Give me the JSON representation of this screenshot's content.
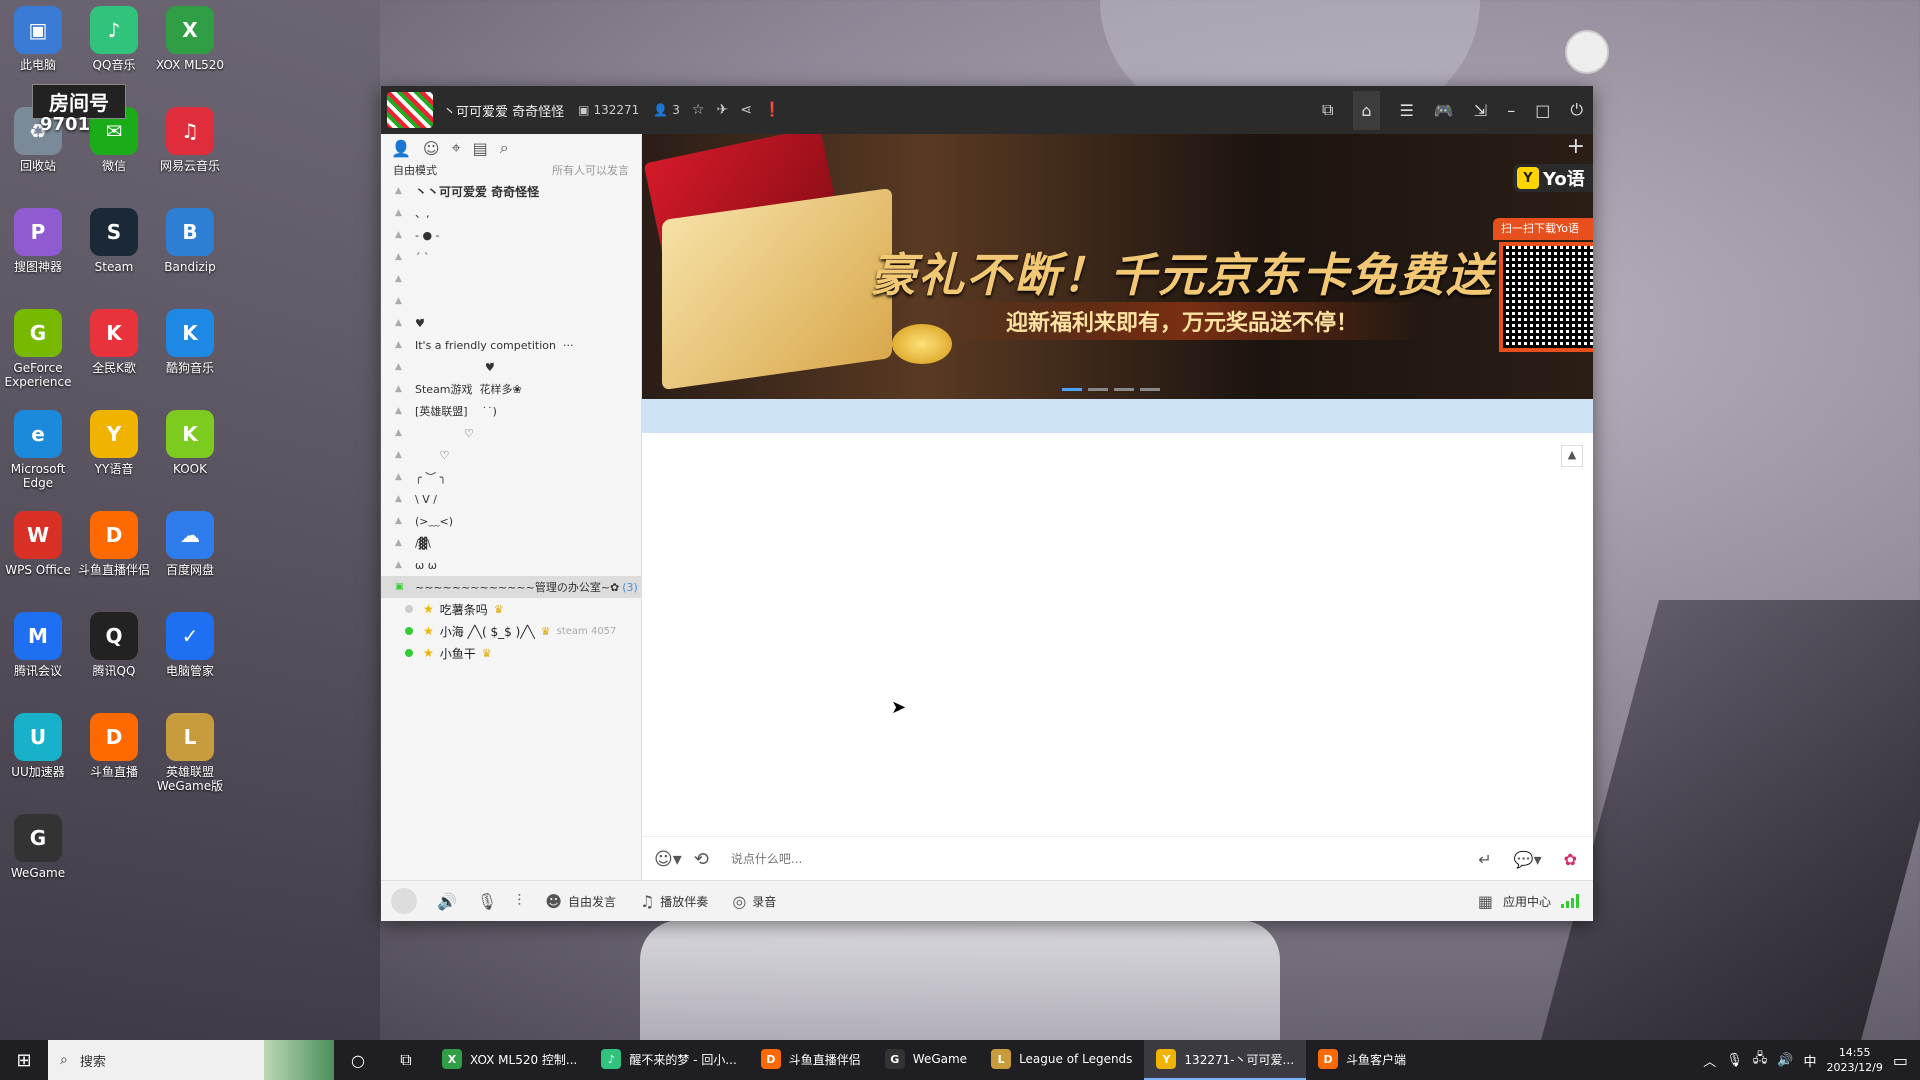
{
  "desktop": {
    "room_badge": "房间号",
    "room_number": "9701",
    "icons": [
      {
        "label": "此电脑",
        "glyph": "▣",
        "color": "#3a7bd5"
      },
      {
        "label": "QQ音乐",
        "glyph": "♪",
        "color": "#31c27c"
      },
      {
        "label": "XOX ML520",
        "glyph": "X",
        "color": "#2f9e44"
      },
      {
        "label": "回收站",
        "glyph": "♻",
        "color": "#7a8a99"
      },
      {
        "label": "微信",
        "glyph": "✉",
        "color": "#1aad19"
      },
      {
        "label": "网易云音乐",
        "glyph": "♫",
        "color": "#e02d3c"
      },
      {
        "label": "搜图神器",
        "glyph": "P",
        "color": "#8e5bd1"
      },
      {
        "label": "Steam",
        "glyph": "S",
        "color": "#1b2838"
      },
      {
        "label": "Bandizip",
        "glyph": "B",
        "color": "#2d7fd6"
      },
      {
        "label": "GeForce Experience",
        "glyph": "G",
        "color": "#76b900"
      },
      {
        "label": "全民K歌",
        "glyph": "K",
        "color": "#e8323c"
      },
      {
        "label": "酷狗音乐",
        "glyph": "K",
        "color": "#1e88e5"
      },
      {
        "label": "Microsoft Edge",
        "glyph": "e",
        "color": "#1c8adb"
      },
      {
        "label": "YY语音",
        "glyph": "Y",
        "color": "#f0b400"
      },
      {
        "label": "KOOK",
        "glyph": "K",
        "color": "#7ecb20"
      },
      {
        "label": "WPS Office",
        "glyph": "W",
        "color": "#d93025"
      },
      {
        "label": "斗鱼直播伴侣",
        "glyph": "D",
        "color": "#ff6a00"
      },
      {
        "label": "百度网盘",
        "glyph": "☁",
        "color": "#2f7ded"
      },
      {
        "label": "腾讯会议",
        "glyph": "M",
        "color": "#1e6ff1"
      },
      {
        "label": "腾讯QQ",
        "glyph": "Q",
        "color": "#222222"
      },
      {
        "label": "电脑管家",
        "glyph": "✓",
        "color": "#1e6ff1"
      },
      {
        "label": "UU加速器",
        "glyph": "U",
        "color": "#17b2c9"
      },
      {
        "label": "斗鱼直播",
        "glyph": "D",
        "color": "#ff6a00"
      },
      {
        "label": "英雄联盟 WeGame版",
        "glyph": "L",
        "color": "#c89b3c"
      },
      {
        "label": "WeGame",
        "glyph": "G",
        "color": "#333333"
      }
    ]
  },
  "window": {
    "title": "丶可可爱爱 奇奇怪怪",
    "room_id": "132271",
    "online_count": "3"
  },
  "left_panel": {
    "mode": "自由模式",
    "permission": "所有人可以发言",
    "channels": [
      {
        "text": "丶丶可可爱爱 奇奇怪怪",
        "head": true
      },
      {
        "text": "、,"
      },
      {
        "text": "- ● -"
      },
      {
        "text": "´ `"
      },
      {
        "text": ""
      },
      {
        "text": ""
      },
      {
        "text": "♥̆̈"
      },
      {
        "text": "It's a friendly competition  ···"
      },
      {
        "text": "                    ♥̆̈"
      },
      {
        "text": "Steam游戏  花样多❀"
      },
      {
        "text": "[英雄联盟]    ˙˙)"
      },
      {
        "text": "              ♡"
      },
      {
        "text": "       ♡"
      },
      {
        "text": "╭ ︶ ╮"
      },
      {
        "text": "\\ V /"
      },
      {
        "text": "(>﹏<)"
      },
      {
        "text": "/▓\\"
      },
      {
        "text": "ω ω"
      }
    ],
    "sub_channel": {
      "name": "~~~~~~~~~~~~~管理の办公室~✿",
      "count": "(3)"
    },
    "members": [
      {
        "name": "吃薯条吗",
        "extra": "",
        "online": false
      },
      {
        "name": "小海 ╱╲( $_$ )╱╲",
        "extra": "steam 4057",
        "online": true
      },
      {
        "name": "小鱼干",
        "extra": "",
        "online": true
      }
    ]
  },
  "banner": {
    "title": "豪礼不断！千元京东卡免费送",
    "subtitle": "迎新福利来即有，万元奖品送不停！",
    "qr_label": "扫一扫下载Yo语",
    "brand": "Yo语"
  },
  "input": {
    "placeholder": "说点什么吧..."
  },
  "bottom_bar": {
    "free_speak": "自由发言",
    "play_music": "播放伴奏",
    "record": "录音",
    "app_center": "应用中心"
  },
  "taskbar": {
    "search": "搜索",
    "tasks": [
      {
        "label": "XOX ML520 控制...",
        "glyph": "X",
        "color": "#2f9e44",
        "active": false
      },
      {
        "label": "醒不来的梦 - 回小...",
        "glyph": "♪",
        "color": "#31c27c",
        "active": false
      },
      {
        "label": "斗鱼直播伴侣",
        "glyph": "D",
        "color": "#ff6a00",
        "active": false
      },
      {
        "label": "WeGame",
        "glyph": "G",
        "color": "#333333",
        "active": false
      },
      {
        "label": "League of Legends",
        "glyph": "L",
        "color": "#c89b3c",
        "active": false
      },
      {
        "label": "132271-丶可可爱...",
        "glyph": "Y",
        "color": "#f0b400",
        "active": true
      },
      {
        "label": "斗鱼客户端",
        "glyph": "D",
        "color": "#ff6a00",
        "active": false
      }
    ],
    "ime": "中",
    "time": "14:55",
    "date": "2023/12/9"
  }
}
